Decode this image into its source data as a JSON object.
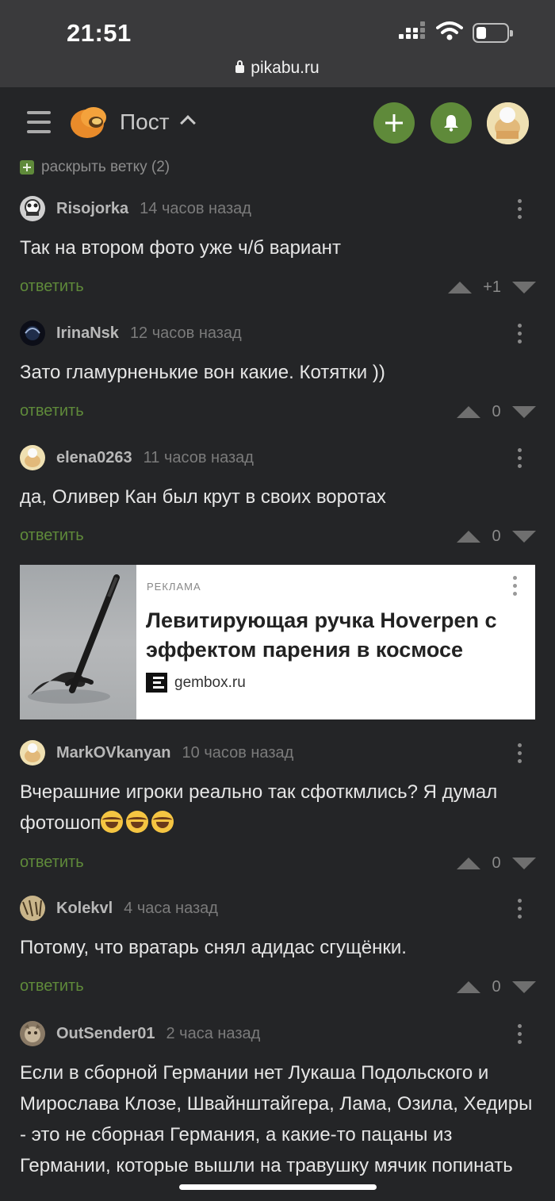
{
  "status_bar": {
    "time": "21:51",
    "url": "pikabu.ru"
  },
  "header": {
    "title": "Пост"
  },
  "thread": {
    "expand_label": "раскрыть ветку (2)"
  },
  "comments": [
    {
      "user": "Risojorka",
      "time": "14 часов назад",
      "text": "Так на втором фото уже ч/б вариант",
      "reply": "ответить",
      "score": "+1"
    },
    {
      "user": "IrinaNsk",
      "time": "12 часов назад",
      "text": "Зато гламурненькие вон какие. Котятки ))",
      "reply": "ответить",
      "score": "0"
    },
    {
      "user": "elena0263",
      "time": "11 часов назад",
      "text": "да, Оливер Кан был крут в своих воротах",
      "reply": "ответить",
      "score": "0"
    },
    {
      "user": "MarkOVkanyan",
      "time": "10 часов назад",
      "text": "Вчерашние игроки реально так сфоткмлись? Я думал фотошоп",
      "emoji_count": 3,
      "reply": "ответить",
      "score": "0"
    },
    {
      "user": "Kolekvl",
      "time": "4 часа назад",
      "text": "Потому, что вратарь снял адидас сгущёнки.",
      "reply": "ответить",
      "score": "0"
    },
    {
      "user": "OutSender01",
      "time": "2 часа назад",
      "text": "Если в сборной Германии нет Лукаша Подольского и Мирослава Клозе, Швайнштайгера, Лама, Озила, Хедиры - это не сборная Германия, а какие-то пацаны из Германии, которые вышли на травушку мячик попинать"
    }
  ],
  "ad": {
    "label": "РЕКЛАМА",
    "title": "Левитирующая ручка Hoverpen с эффектом парения в космосе",
    "source": "gembox.ru"
  },
  "colors": {
    "accent": "#5f8a3a",
    "background": "#242527"
  }
}
